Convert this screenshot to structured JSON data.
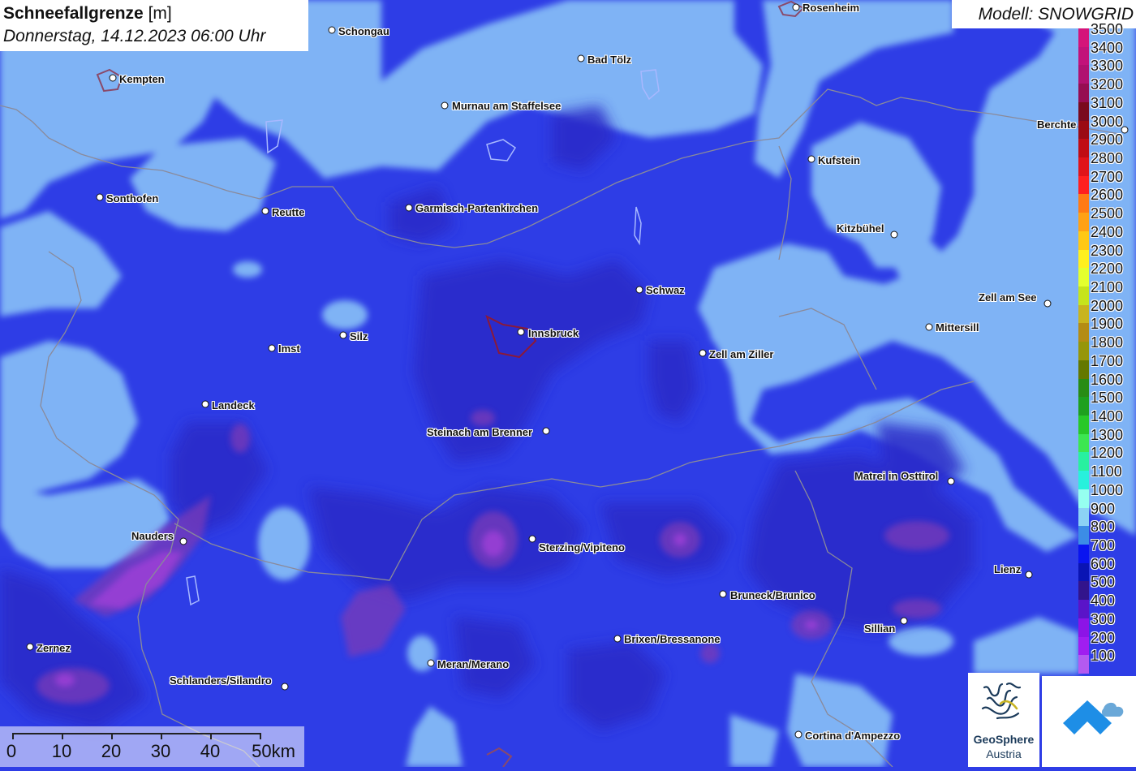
{
  "title": {
    "variable": "Schneefallgrenze",
    "unit": "[m]",
    "datetime": "Donnerstag, 14.12.2023 06:00 Uhr"
  },
  "model": {
    "label": "Modell: SNOWGRID"
  },
  "legend": {
    "items": [
      {
        "value": "3500",
        "color": "#d4147a"
      },
      {
        "value": "3400",
        "color": "#c2127a"
      },
      {
        "value": "3300",
        "color": "#b01170"
      },
      {
        "value": "3200",
        "color": "#960d52"
      },
      {
        "value": "3100",
        "color": "#7a0a1e"
      },
      {
        "value": "3000",
        "color": "#9b0a14"
      },
      {
        "value": "2900",
        "color": "#c00d14"
      },
      {
        "value": "2800",
        "color": "#e0141a"
      },
      {
        "value": "2700",
        "color": "#ff2020"
      },
      {
        "value": "2600",
        "color": "#ff7a14"
      },
      {
        "value": "2500",
        "color": "#ffa114"
      },
      {
        "value": "2400",
        "color": "#ffc814"
      },
      {
        "value": "2300",
        "color": "#fff01e"
      },
      {
        "value": "2200",
        "color": "#e4ff2e"
      },
      {
        "value": "2100",
        "color": "#c6e41c"
      },
      {
        "value": "2000",
        "color": "#c8b41e"
      },
      {
        "value": "1900",
        "color": "#b48c14"
      },
      {
        "value": "1800",
        "color": "#96960a"
      },
      {
        "value": "1700",
        "color": "#647800"
      },
      {
        "value": "1600",
        "color": "#288c14"
      },
      {
        "value": "1500",
        "color": "#1ea01e"
      },
      {
        "value": "1400",
        "color": "#28c828"
      },
      {
        "value": "1300",
        "color": "#3ce650"
      },
      {
        "value": "1200",
        "color": "#28f0a0"
      },
      {
        "value": "1100",
        "color": "#28f0dc"
      },
      {
        "value": "1000",
        "color": "#96fff0"
      },
      {
        "value": "900",
        "color": "#8cd2f5"
      },
      {
        "value": "800",
        "color": "#3c8ce6"
      },
      {
        "value": "700",
        "color": "#0a14f0"
      },
      {
        "value": "600",
        "color": "#0a14b4"
      },
      {
        "value": "500",
        "color": "#32148c"
      },
      {
        "value": "400",
        "color": "#5a14c8"
      },
      {
        "value": "300",
        "color": "#8c14e6"
      },
      {
        "value": "200",
        "color": "#a01ef0"
      },
      {
        "value": "100",
        "color": "#b45af0"
      }
    ]
  },
  "towns": [
    {
      "name": "Schongau"
    },
    {
      "name": "Rosenheim"
    },
    {
      "name": "Kempten"
    },
    {
      "name": "Bad Tölz"
    },
    {
      "name": "Murnau am Staffelsee"
    },
    {
      "name": "Berchte"
    },
    {
      "name": "Kufstein"
    },
    {
      "name": "Sonthofen"
    },
    {
      "name": "Reutte"
    },
    {
      "name": "Garmisch-Partenkirchen"
    },
    {
      "name": "Kitzbühel"
    },
    {
      "name": "Schwaz"
    },
    {
      "name": "Zell am See"
    },
    {
      "name": "Mittersill"
    },
    {
      "name": "Silz"
    },
    {
      "name": "Innsbruck"
    },
    {
      "name": "Imst"
    },
    {
      "name": "Zell am Ziller"
    },
    {
      "name": "Landeck"
    },
    {
      "name": "Steinach am Brenner"
    },
    {
      "name": "Matrei in Osttirol"
    },
    {
      "name": "Nauders"
    },
    {
      "name": "Sterzing/Vipiteno"
    },
    {
      "name": "Lienz"
    },
    {
      "name": "Bruneck/Brunico"
    },
    {
      "name": "Sillian"
    },
    {
      "name": "Zernez"
    },
    {
      "name": "Brixen/Bressanone"
    },
    {
      "name": "Meran/Merano"
    },
    {
      "name": "Schlanders/Silandro"
    },
    {
      "name": "Cortina d'Ampezzo"
    }
  ],
  "scale": {
    "labels": [
      "0",
      "10",
      "20",
      "30",
      "40",
      "50km"
    ]
  },
  "logos": {
    "geosphere_line1": "GeoSphere",
    "geosphere_line2": "Austria"
  },
  "colors": {
    "base_700": "#2e3de6",
    "zone_800": "#7fb3f5",
    "zone_600": "#2a2cc8",
    "zone_500": "#3a2a96",
    "zone_400": "#6a2ab4",
    "zone_300": "#a040d8",
    "border": "#8a8a9a"
  }
}
